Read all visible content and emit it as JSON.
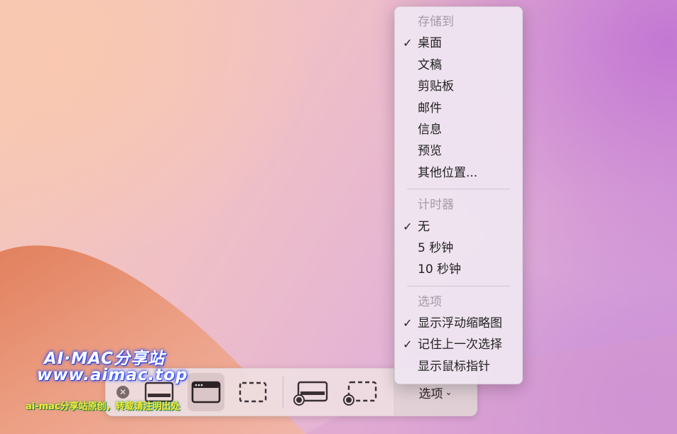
{
  "toolbar": {
    "close_symbol": "✕",
    "options_label": "选项",
    "options_chevron": "⌄",
    "modes": [
      {
        "name": "capture-entire-screen-icon"
      },
      {
        "name": "capture-window-icon",
        "selected": true
      },
      {
        "name": "capture-selection-icon"
      },
      {
        "name": "record-entire-screen-icon"
      },
      {
        "name": "record-selection-icon"
      }
    ]
  },
  "menu": {
    "save_header": "存储到",
    "save_items": [
      {
        "label": "桌面",
        "checked": true
      },
      {
        "label": "文稿",
        "checked": false
      },
      {
        "label": "剪贴板",
        "checked": false
      },
      {
        "label": "邮件",
        "checked": false
      },
      {
        "label": "信息",
        "checked": false
      },
      {
        "label": "预览",
        "checked": false
      },
      {
        "label": "其他位置...",
        "checked": false
      }
    ],
    "timer_header": "计时器",
    "timer_items": [
      {
        "label": "无",
        "checked": true
      },
      {
        "label": "5 秒钟",
        "checked": false
      },
      {
        "label": "10 秒钟",
        "checked": false
      }
    ],
    "options_header": "选项",
    "options_items": [
      {
        "label": "显示浮动缩略图",
        "checked": true
      },
      {
        "label": "记住上一次选择",
        "checked": true
      },
      {
        "label": "显示鼠标指针",
        "checked": false
      }
    ],
    "check_symbol": "✓"
  },
  "watermark": {
    "line1": "AI·MAC分享站",
    "line2": "www.aimac.top",
    "line3": "ai-mac分享站原创，转载请注明出处"
  },
  "colors": {
    "wallpaper_orange": "#e88a63",
    "accent_text": "#222222",
    "menu_header": "#a79aa8"
  }
}
